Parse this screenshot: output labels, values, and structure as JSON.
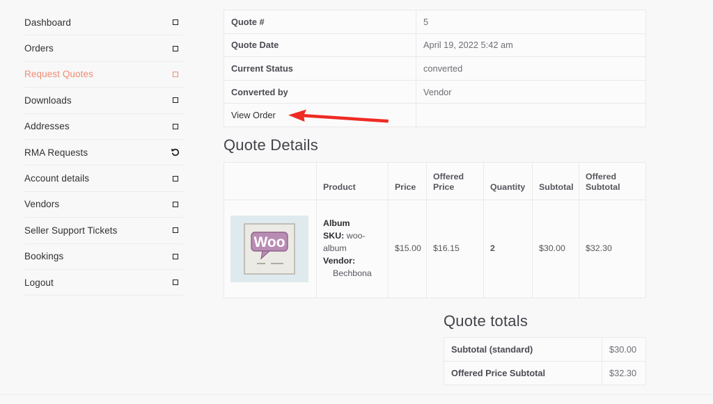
{
  "sidebar": {
    "items": [
      {
        "label": "Dashboard",
        "icon": "square-icon",
        "active": false
      },
      {
        "label": "Orders",
        "icon": "square-icon",
        "active": false
      },
      {
        "label": "Request Quotes",
        "icon": "square-icon",
        "active": true
      },
      {
        "label": "Downloads",
        "icon": "square-icon",
        "active": false
      },
      {
        "label": "Addresses",
        "icon": "square-icon",
        "active": false
      },
      {
        "label": "RMA Requests",
        "icon": "undo-arrow-icon",
        "active": false
      },
      {
        "label": "Account details",
        "icon": "square-icon",
        "active": false
      },
      {
        "label": "Vendors",
        "icon": "square-icon",
        "active": false
      },
      {
        "label": "Seller Support Tickets",
        "icon": "square-icon",
        "active": false
      },
      {
        "label": "Bookings",
        "icon": "square-icon",
        "active": false
      },
      {
        "label": "Logout",
        "icon": "square-icon",
        "active": false
      }
    ],
    "active_color": "#ef8b73"
  },
  "quote_info": {
    "rows": [
      {
        "label": "Quote #",
        "value": "5"
      },
      {
        "label": "Quote Date",
        "value": "April 19, 2022 5:42 am"
      },
      {
        "label": "Current Status",
        "value": "converted"
      },
      {
        "label": "Converted by",
        "value": "Vendor"
      }
    ],
    "view_order_label": "View Order"
  },
  "quote_details": {
    "title": "Quote Details",
    "headers": [
      "",
      "Product",
      "Price",
      "Offered Price",
      "Quantity",
      "Subtotal",
      "Offered Subtotal"
    ],
    "rows": [
      {
        "thumbnail_alt": "woo-album-cover-image",
        "product_name": "Album",
        "sku_label": "SKU:",
        "sku_value": "woo-album",
        "vendor_label": "Vendor:",
        "vendor_value": "Bechbona",
        "price": "$15.00",
        "offered_price": "$16.15",
        "quantity": "2",
        "subtotal": "$30.00",
        "offered_subtotal": "$32.30"
      }
    ]
  },
  "quote_totals": {
    "title": "Quote totals",
    "rows": [
      {
        "label": "Subtotal (standard)",
        "value": "$30.00"
      },
      {
        "label": "Offered Price Subtotal",
        "value": "$32.30"
      }
    ]
  },
  "annotation": {
    "type": "red-arrow-pointing-left",
    "color": "#ee2b24",
    "points_to": "View Order"
  }
}
